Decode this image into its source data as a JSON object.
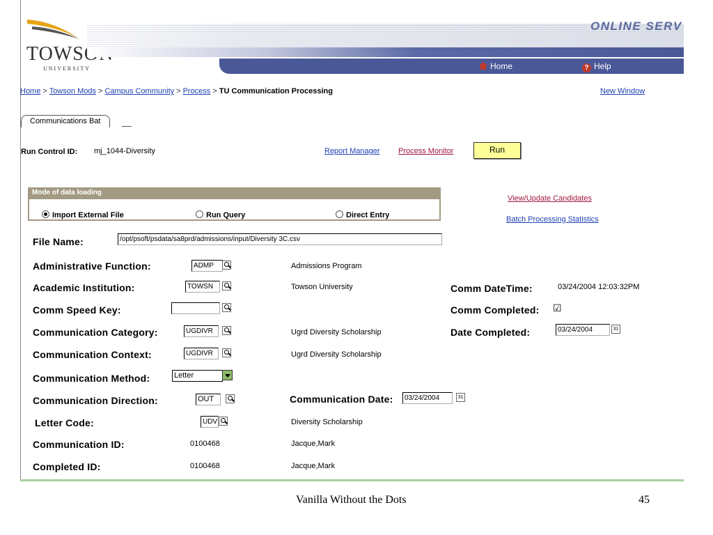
{
  "header": {
    "logo_text": "TOWSON",
    "logo_subtext": "UNIVERSITY",
    "banner_text": "ONLINE SERV",
    "home_label": "Home",
    "help_label": "Help"
  },
  "breadcrumb": {
    "items": [
      "Home",
      "Towson Mods",
      "Campus Community",
      "Process"
    ],
    "separator": ">",
    "current": "TU Communication Processing",
    "new_window": "New Window"
  },
  "tab": {
    "label": "Communications Bat"
  },
  "run_control": {
    "label": "Run Control ID:",
    "value": "mj_1044-Diversity",
    "report_manager": "Report Manager",
    "process_monitor": "Process Monitor",
    "run_label": "Run"
  },
  "mode": {
    "title": "Mode of data loading",
    "options": [
      {
        "label": "Import External File",
        "selected": true
      },
      {
        "label": "Run Query",
        "selected": false
      },
      {
        "label": "Direct Entry",
        "selected": false
      }
    ]
  },
  "side_links": {
    "view_update": "View/Update Candidates",
    "batch_stats": "Batch Processing Statistics"
  },
  "form": {
    "file_name": {
      "label": "File Name:",
      "value": "/opt/psoft/psdata/sa8prd/admissions/input/Diversity 3C.csv"
    },
    "admin_function": {
      "label": "Administrative Function:",
      "value": "ADMP",
      "desc": "Admissions Program"
    },
    "academic_institution": {
      "label": "Academic Institution:",
      "value": "TOWSN",
      "desc": "Towson University"
    },
    "comm_speed_key": {
      "label": "Comm Speed Key:",
      "value": ""
    },
    "comm_category": {
      "label": "Communication Category:",
      "value": "UGDIVR",
      "desc": "Ugrd Diversity Scholarship"
    },
    "comm_context": {
      "label": "Communication Context:",
      "value": "UGDIVR",
      "desc": "Ugrd Diversity Scholarship"
    },
    "comm_method": {
      "label": "Communication Method:",
      "value": "Letter"
    },
    "comm_direction": {
      "label": "Communication Direction:",
      "value": "OUT"
    },
    "comm_date": {
      "label": "Communication Date:",
      "value": "03/24/2004"
    },
    "letter_code": {
      "label": "Letter Code:",
      "value": "UDV",
      "desc": "Diversity Scholarship"
    },
    "comm_id": {
      "label": "Communication ID:",
      "value": "0100468",
      "desc": "Jacque,Mark"
    },
    "completed_id": {
      "label": "Completed ID:",
      "value": "0100468",
      "desc": "Jacque,Mark"
    },
    "comm_datetime": {
      "label": "Comm DateTime:",
      "value": "03/24/2004 12:03:32PM"
    },
    "comm_completed": {
      "label": "Comm Completed:",
      "checked": true,
      "mark": "☑"
    },
    "date_completed": {
      "label": "Date Completed:",
      "value": "03/24/2004"
    }
  },
  "footer": {
    "title": "Vanilla Without the Dots",
    "page": "45"
  },
  "colors": {
    "nav": "#4a5898",
    "link": "#1f3fb3",
    "maroon_link": "#a0173a",
    "group_header": "#a39a82",
    "run_button": "#ffff99"
  }
}
